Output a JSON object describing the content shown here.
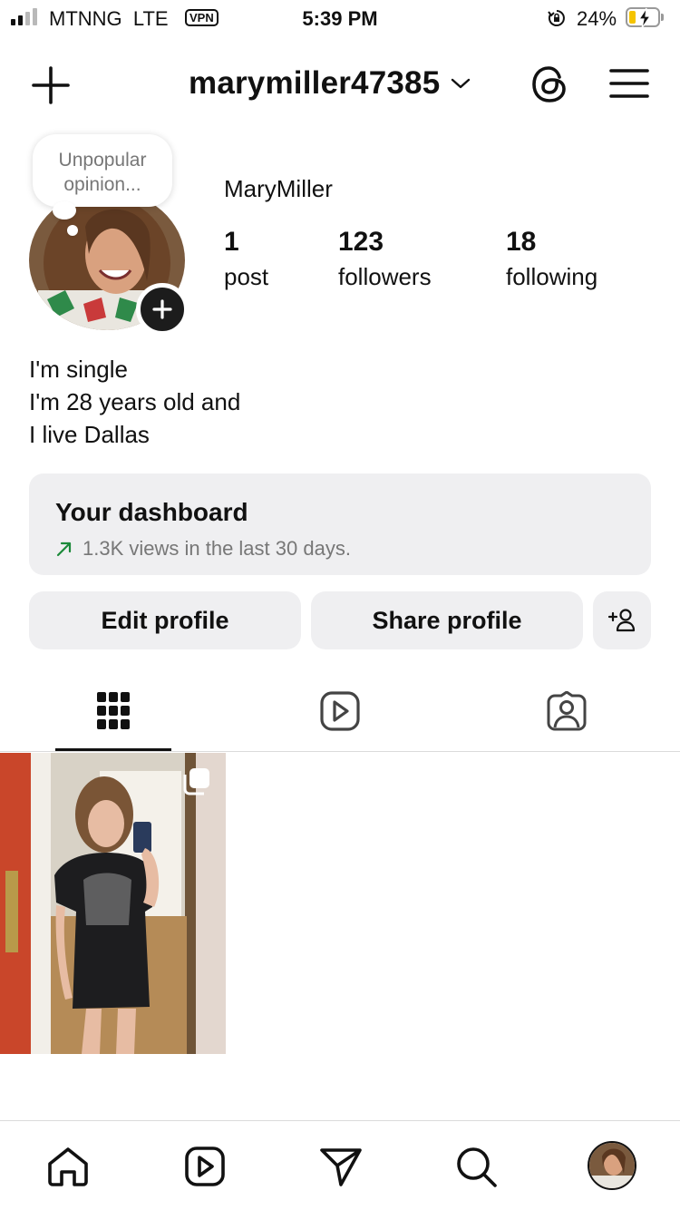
{
  "status_bar": {
    "carrier": "MTNNG",
    "network": "LTE",
    "vpn": "VPN",
    "time": "5:39 PM",
    "battery": "24%",
    "battery_level": 0.24,
    "battery_color": "#f5c400",
    "signal_bars_filled": 2,
    "signal_bars_total": 4
  },
  "header": {
    "username": "marymiller47385",
    "icons": [
      "plus-icon",
      "chevron-down-icon",
      "threads-icon",
      "menu-icon"
    ]
  },
  "profile": {
    "note": {
      "line1": "Unpopular",
      "line2": "opinion..."
    },
    "display_name": "MaryMiller",
    "stats": {
      "posts": {
        "value": "1",
        "label": "post"
      },
      "followers": {
        "value": "123",
        "label": "followers"
      },
      "following": {
        "value": "18",
        "label": "following"
      }
    },
    "bio": [
      "I'm single",
      "I'm 28 years old and",
      "I live Dallas"
    ]
  },
  "dashboard": {
    "title": "Your dashboard",
    "subtitle": "1.3K views in the last 30 days.",
    "trend_color": "#1c8a3a"
  },
  "actions": {
    "edit": "Edit profile",
    "share": "Share profile"
  },
  "tabs": [
    {
      "name": "grid",
      "icon": "grid-icon",
      "active": true
    },
    {
      "name": "reels",
      "icon": "reels-icon",
      "active": false
    },
    {
      "name": "tagged",
      "icon": "tagged-icon",
      "active": false
    }
  ],
  "posts": [
    {
      "type": "carousel",
      "icon": "multiple-photos-icon"
    }
  ],
  "bottom_nav": [
    "home-icon",
    "reels-icon",
    "send-icon",
    "search-icon",
    "profile-avatar"
  ]
}
